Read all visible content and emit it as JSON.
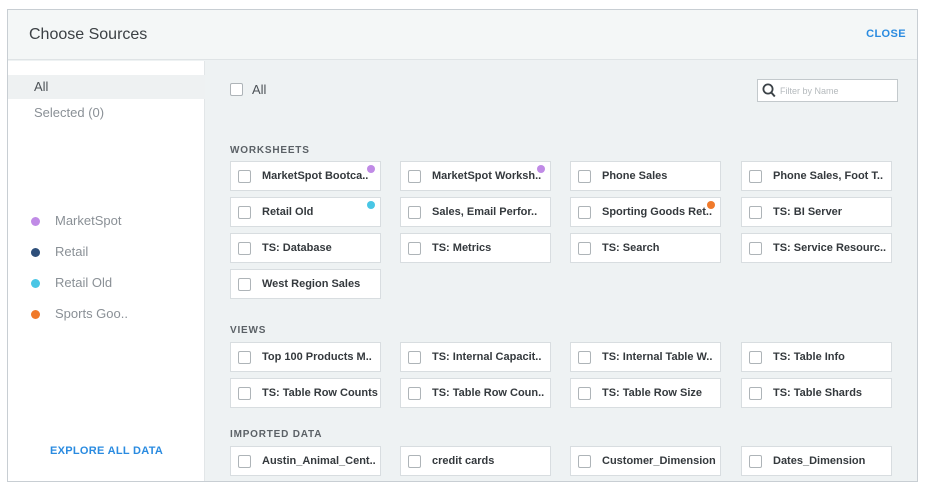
{
  "header": {
    "title": "Choose Sources",
    "close_label": "CLOSE"
  },
  "sidebar": {
    "all_label": "All",
    "selected_label": "Selected (0)",
    "legend": [
      {
        "label": "MarketSpot",
        "color": "#c08be6"
      },
      {
        "label": "Retail",
        "color": "#2e4f7a"
      },
      {
        "label": "Retail Old",
        "color": "#49c6e5"
      },
      {
        "label": "Sports Goo..",
        "color": "#f07a2b"
      }
    ],
    "explore_label": "EXPLORE ALL DATA"
  },
  "main": {
    "all_label": "All",
    "filter_placeholder": "Filter by Name",
    "sections": [
      {
        "title": "WORKSHEETS",
        "items": [
          {
            "label": "MarketSpot Bootca..",
            "dot": "#c08be6"
          },
          {
            "label": "MarketSpot Worksh..",
            "dot": "#c08be6"
          },
          {
            "label": "Phone Sales"
          },
          {
            "label": "Phone Sales, Foot T.."
          },
          {
            "label": "Retail Old",
            "dot": "#49c6e5"
          },
          {
            "label": "Sales, Email Perfor.."
          },
          {
            "label": "Sporting Goods Ret..",
            "dot": "#f07a2b"
          },
          {
            "label": "TS: BI Server"
          },
          {
            "label": "TS: Database"
          },
          {
            "label": "TS: Metrics"
          },
          {
            "label": "TS: Search"
          },
          {
            "label": "TS: Service Resourc.."
          },
          {
            "label": "West Region Sales"
          }
        ]
      },
      {
        "title": "VIEWS",
        "items": [
          {
            "label": "Top 100 Products M.."
          },
          {
            "label": "TS: Internal Capacit.."
          },
          {
            "label": "TS: Internal Table W.."
          },
          {
            "label": "TS: Table Info"
          },
          {
            "label": "TS: Table Row Counts"
          },
          {
            "label": "TS: Table Row Coun.."
          },
          {
            "label": "TS: Table Row Size"
          },
          {
            "label": "TS: Table Shards"
          }
        ]
      },
      {
        "title": "IMPORTED DATA",
        "items": [
          {
            "label": "Austin_Animal_Cent.."
          },
          {
            "label": "credit cards"
          },
          {
            "label": "Customer_Dimension"
          },
          {
            "label": "Dates_Dimension"
          }
        ]
      }
    ]
  }
}
